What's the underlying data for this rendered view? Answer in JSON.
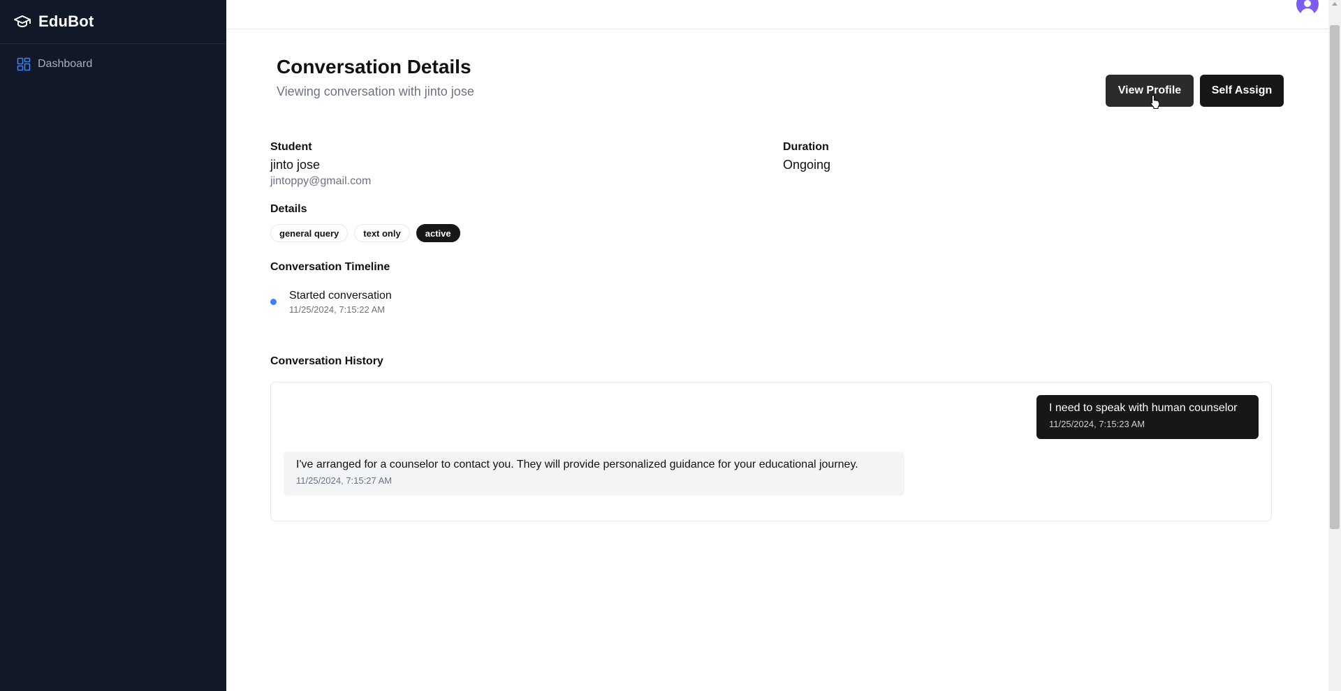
{
  "sidebar": {
    "brand": "EduBot",
    "items": [
      {
        "label": "Dashboard",
        "icon": "dashboard-grid-icon"
      }
    ]
  },
  "header": {
    "title": "Conversation Details",
    "subtitle": "Viewing conversation with jinto jose",
    "actions": {
      "view_profile": "View Profile",
      "self_assign": "Self Assign"
    }
  },
  "student": {
    "label": "Student",
    "name": "jinto jose",
    "email": "jintoppy@gmail.com"
  },
  "duration": {
    "label": "Duration",
    "value": "Ongoing"
  },
  "details": {
    "label": "Details",
    "tags": [
      "general query",
      "text only",
      "active"
    ]
  },
  "timeline": {
    "label": "Conversation Timeline",
    "events": [
      {
        "text": "Started conversation",
        "time": "11/25/2024, 7:15:22 AM"
      }
    ]
  },
  "history": {
    "label": "Conversation History",
    "messages": [
      {
        "role": "user",
        "text": "I need to speak with human counselor",
        "time": "11/25/2024, 7:15:23 AM"
      },
      {
        "role": "bot",
        "text": "I've arranged for a counselor to contact you. They will provide personalized guidance for your educational journey.",
        "time": "11/25/2024, 7:15:27 AM"
      }
    ]
  },
  "colors": {
    "sidebar_bg": "#111827",
    "accent_blue": "#3b82f6",
    "avatar": "#7c5cf4",
    "button_dark": "#171717"
  }
}
